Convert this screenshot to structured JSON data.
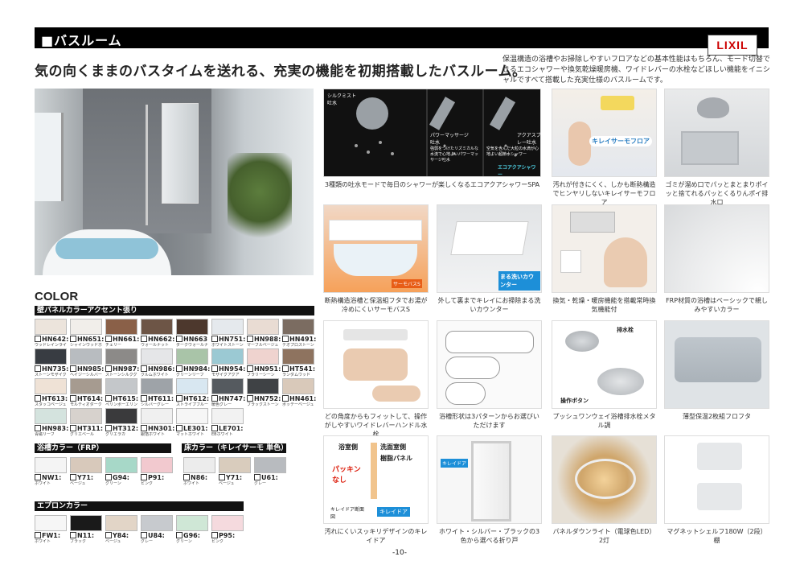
{
  "header": {
    "title": "■バスルーム",
    "brand": "LIXIL"
  },
  "headline": "気の向くままのバスタイムを送れる、充実の機能を初期搭載したバスルーム。",
  "intro": "保温構造の浴槽やお掃除しやすいフロアなどの基本性能はもちろん、モード切替できるエコシャワーや換気乾燥暖房機、ワイドレバーの水栓などほしい機能をイニシャルですべて搭載した充実仕様のバスルームです。",
  "color": {
    "title": "COLOR",
    "wall_heading": "壁パネルカラーアクセント張り",
    "wall_swatches": [
      {
        "code": "HN642:",
        "sub": "ウッドレインライト",
        "color": "#ece4dc"
      },
      {
        "code": "HN651:",
        "sub": "シャインウッドホワイト",
        "color": "#f1eeea"
      },
      {
        "code": "HN661:",
        "sub": "チェリー",
        "color": "#8a6048"
      },
      {
        "code": "HN662:",
        "sub": "ウォールナット",
        "color": "#6d5546"
      },
      {
        "code": "HN663",
        "sub": "ダークウォールナット",
        "color": "#4d382d"
      },
      {
        "code": "HN751:",
        "sub": "ホワイトストーン",
        "color": "#e5e9ed"
      },
      {
        "code": "HN988:",
        "sub": "マーブルベージュ",
        "color": "#e9dcd3"
      },
      {
        "code": "HN491:",
        "sub": "テオプロストーン",
        "color": "#7b6c61"
      },
      {
        "code": "HN735:",
        "sub": "ストーンモザイクダーク",
        "color": "#383c42"
      },
      {
        "code": "HN985:",
        "sub": "ヘイジーシルバー",
        "color": "#b8bcc0"
      },
      {
        "code": "HN987:",
        "sub": "ストーンシルクグレー",
        "color": "#8c8a88"
      },
      {
        "code": "HN986:",
        "sub": "クルムホワイト",
        "color": "#e5e6e8"
      },
      {
        "code": "HN984:",
        "sub": "グリーンリーフ",
        "color": "#a9c4a8"
      },
      {
        "code": "HN954:",
        "sub": "モザイクアクア",
        "color": "#9bc9d3"
      },
      {
        "code": "HN951:",
        "sub": "フラリーシーン",
        "color": "#efd3cf"
      },
      {
        "code": "HT541:",
        "sub": "ランダムウッド",
        "color": "#8e735f"
      },
      {
        "code": "HT613:",
        "sub": "スタッコベージュ",
        "color": "#efe2d6"
      },
      {
        "code": "HT614:",
        "sub": "モルティオダーク",
        "color": "#a69b90"
      },
      {
        "code": "HT615:",
        "sub": "ペリンボーエリン",
        "color": "#c4c7ca"
      },
      {
        "code": "HT611:",
        "sub": "シルバーグレー",
        "color": "#9ea3a8"
      },
      {
        "code": "HT612:",
        "sub": "ストライプブルー",
        "color": "#d8e7f1"
      },
      {
        "code": "HN747:",
        "sub": "暖色グレー",
        "color": "#555a5f"
      },
      {
        "code": "HN752:",
        "sub": "ブラックストーン",
        "color": "#3f4245"
      },
      {
        "code": "HN461:",
        "sub": "ボッテーベージュ",
        "color": "#d9c9ba"
      },
      {
        "code": "HN983:",
        "sub": "青磁リーフ",
        "color": "#d4e3de"
      },
      {
        "code": "HT311:",
        "sub": "グリエベール",
        "color": "#d7d2cd"
      },
      {
        "code": "HT312:",
        "sub": "グリエラカ",
        "color": "#3a3a3c"
      },
      {
        "code": "HN301:",
        "sub": "銀箔ホワイト",
        "color": "#f0f0f0"
      },
      {
        "code": "LE301:",
        "sub": "マットホワイト",
        "color": "#f6f6f6"
      },
      {
        "code": "LE701:",
        "sub": "EBホワイト",
        "color": "#f2f2f2"
      }
    ],
    "tub_heading": "浴槽カラー（FRP）",
    "tub_swatches": [
      {
        "code": "NW1:",
        "sub": "ホワイト",
        "color": "#f4f4f4"
      },
      {
        "code": "Y71:",
        "sub": "ベージュ",
        "color": "#d8c9bb"
      },
      {
        "code": "G94:",
        "sub": "グリーン",
        "color": "#a7d8c8"
      },
      {
        "code": "P91:",
        "sub": "ピンク",
        "color": "#f2c9cf"
      }
    ],
    "floor_heading": "床カラー（キレイサーモ 単色）",
    "floor_swatches": [
      {
        "code": "N86:",
        "sub": "ホワイト",
        "color": "#ececec"
      },
      {
        "code": "Y71:",
        "sub": "ベージュ",
        "color": "#d9ccbd"
      },
      {
        "code": "U61:",
        "sub": "グレー",
        "color": "#b8bbbf"
      }
    ],
    "apron_heading": "エプロンカラー",
    "apron_swatches": [
      {
        "code": "FW1:",
        "sub": "ホワイト",
        "color": "#f6f6f6"
      },
      {
        "code": "N11:",
        "sub": "ブラック",
        "color": "#1a1a1a"
      },
      {
        "code": "Y84:",
        "sub": "ベージュ",
        "color": "#e2d5c7"
      },
      {
        "code": "U84:",
        "sub": "グレー",
        "color": "#c7cace"
      },
      {
        "code": "G96:",
        "sub": "グリーン",
        "color": "#cfe7d6"
      },
      {
        "code": "P95:",
        "sub": "ピンク",
        "color": "#f5dade"
      }
    ]
  },
  "shower_labels": {
    "mist": "シルクミスト吐水",
    "power": "パワーマッサージ吐水",
    "aqua": "アクアスプレー吐水",
    "power_desc": "強弱をつけたリズミカルな水流で心地よいパワーマッサージ吐水",
    "aqua_desc": "空気を含んだ大粒の水滴が心地よい超節水シャワー",
    "eco_badge": "エコアクアシャワー"
  },
  "badges": {
    "kirei_thermo": "キレイサーモフロア",
    "thermo_s": "サーモバスS",
    "marusen": "まる洗いカウンター",
    "kirei_door": "キレイドア",
    "drain": "排水栓",
    "op_button": "操作ボタン"
  },
  "door_diagram": {
    "bath_side": "浴室側",
    "wash_side": "洗面室側",
    "resin": "樹脂パネル",
    "packing": "パッキンなし",
    "section": "キレイドア断面図"
  },
  "features": [
    {
      "caption": "3種類の吐水モードで毎日のシャワーが楽しくなるエコアクアシャワーSPA"
    },
    {
      "caption": "汚れが付きにくく、しかも断熱構造でヒンヤリしないキレイサーモフロア"
    },
    {
      "caption": "ゴミが溜め口でパッとまとまりポイッと捨てれるパッとくるりんポイ排水口"
    },
    {
      "caption": "断熱構造浴槽と保温組フタでお湯が冷めにくいサーモバスS"
    },
    {
      "caption": "外して裏までキレイにお掃除まる洗いカウンター"
    },
    {
      "caption": "換気・乾燥・暖房機能を搭載常時換気機能付"
    },
    {
      "caption": "FRP材質の浴槽はベーシックで親しみやすいカラー"
    },
    {
      "caption": "どの角度からもフィットして、操作がしやすいワイドレバーハンドル水栓"
    },
    {
      "caption": "浴槽形状は3パターンからお選びいただけます"
    },
    {
      "caption": "プッシュワンウェイ浴槽排水栓メタル調"
    },
    {
      "caption": "薄型保温2枚組フロフタ"
    },
    {
      "caption": "汚れにくいスッキリデザインのキレイドア"
    },
    {
      "caption": "ホワイト・シルバー・ブラックの3色から選べる折り戸"
    },
    {
      "caption": "パネルダウンライト（電球色LED）2灯"
    },
    {
      "caption": "マグネットシェルフ180W（2段）棚"
    }
  ],
  "page_number": "-10-"
}
